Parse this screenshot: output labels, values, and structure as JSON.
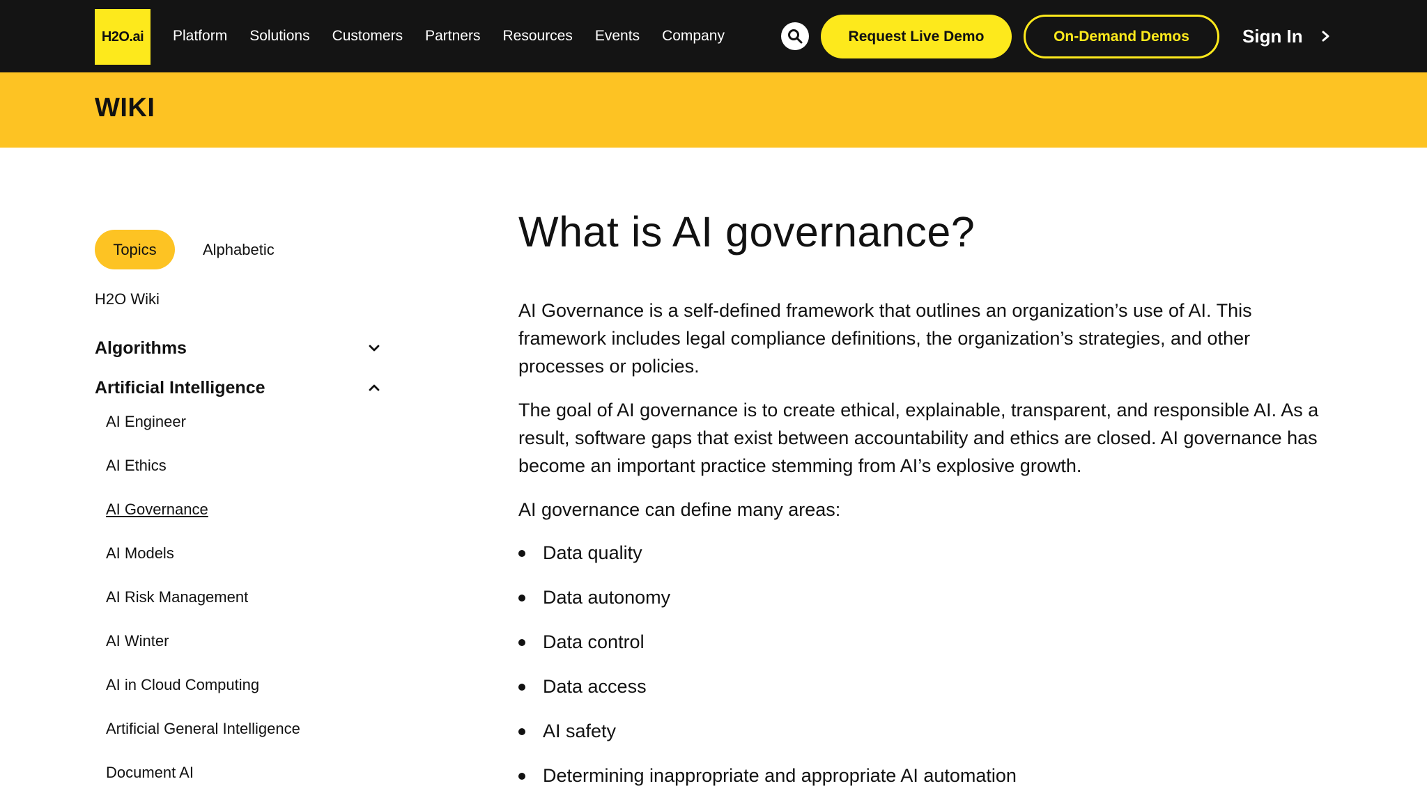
{
  "header": {
    "logo_text": "H2O.ai",
    "nav_items": [
      "Platform",
      "Solutions",
      "Customers",
      "Partners",
      "Resources",
      "Events",
      "Company"
    ],
    "search_icon": "search-icon",
    "request_demo_label": "Request Live Demo",
    "on_demand_label": "On-Demand Demos",
    "sign_in_label": "Sign In",
    "colors": {
      "bar": "#141414",
      "brand_yellow": "#fde91c"
    }
  },
  "banner": {
    "title": "WIKI",
    "color": "#fdc323"
  },
  "sidebar": {
    "tabs": [
      {
        "label": "Topics",
        "active": true
      },
      {
        "label": "Alphabetic",
        "active": false
      }
    ],
    "home_link": "H2O Wiki",
    "categories": [
      {
        "label": "Algorithms",
        "expanded": false,
        "icon": "chevron-down-icon"
      },
      {
        "label": "Artificial Intelligence",
        "expanded": true,
        "icon": "chevron-up-icon"
      }
    ],
    "items": [
      {
        "label": "AI Engineer",
        "current": false
      },
      {
        "label": "AI Ethics",
        "current": false
      },
      {
        "label": "AI Governance",
        "current": true
      },
      {
        "label": "AI Models",
        "current": false
      },
      {
        "label": "AI Risk Management",
        "current": false
      },
      {
        "label": "AI Winter",
        "current": false
      },
      {
        "label": "AI in Cloud Computing",
        "current": false
      },
      {
        "label": "Artificial General Intelligence",
        "current": false
      },
      {
        "label": "Document AI",
        "current": false
      }
    ]
  },
  "article": {
    "title": "What is AI governance?",
    "paragraphs": [
      "AI Governance is a self-defined framework that outlines an organization’s use of AI. This framework includes legal compliance definitions, the organization’s strategies, and other processes or policies.",
      "The goal of AI governance is to create ethical, explainable, transparent, and responsible AI. As a result, software gaps that exist between accountability and ethics are closed. AI governance has become an important practice stemming from AI’s explosive growth.",
      "AI governance can define many areas:"
    ],
    "bullets": [
      "Data quality",
      "Data autonomy",
      "Data control",
      "Data access",
      "AI safety",
      "Determining inappropriate and appropriate AI automation"
    ]
  }
}
